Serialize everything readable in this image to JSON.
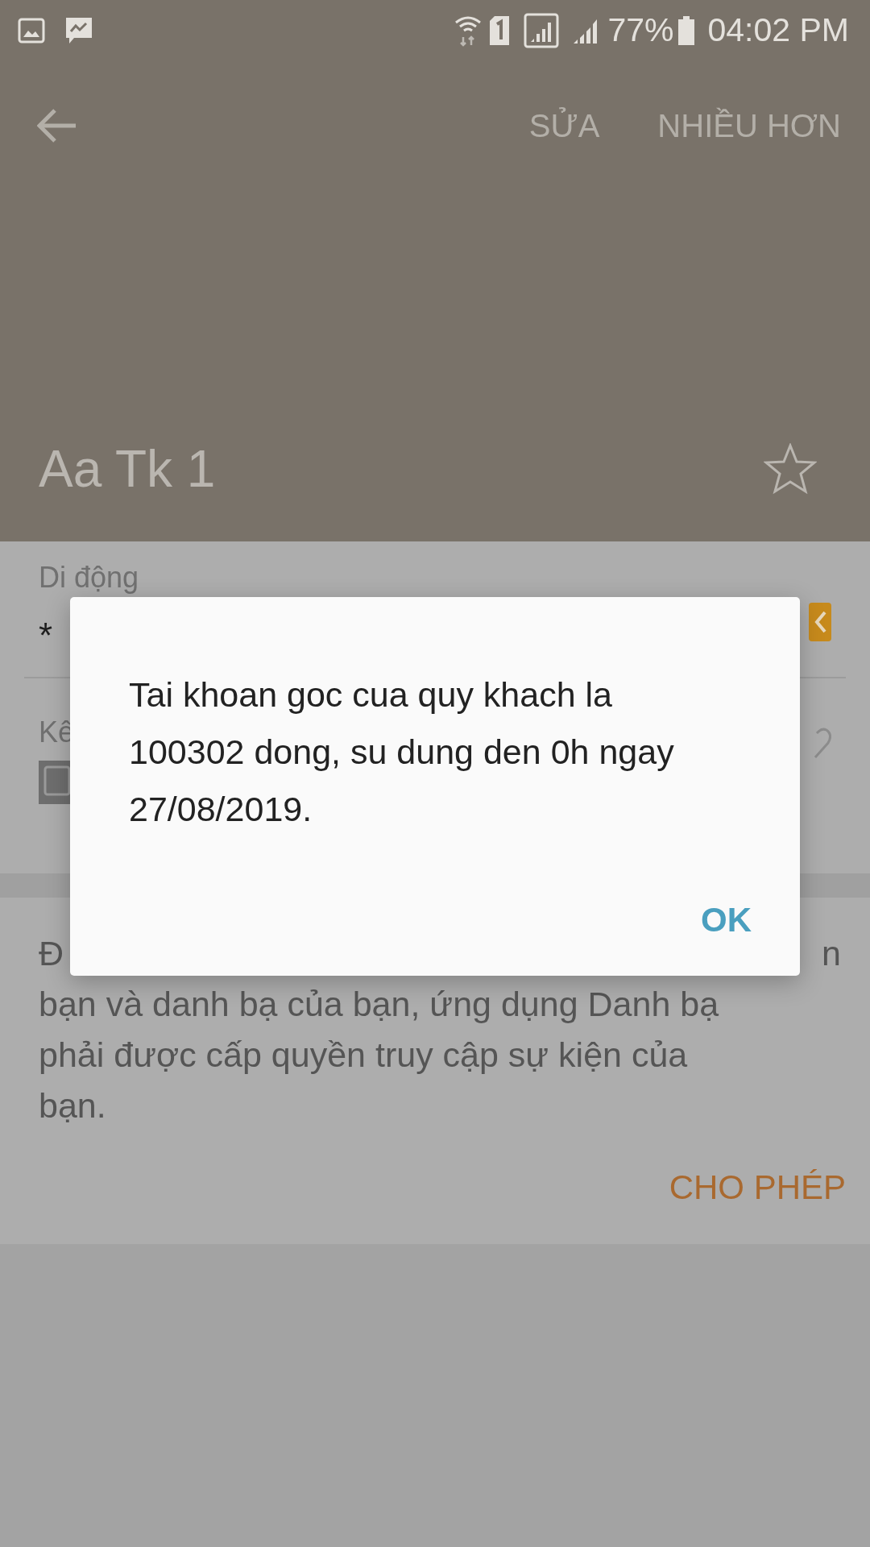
{
  "status_bar": {
    "battery": "77%",
    "time": "04:02 PM"
  },
  "app_bar": {
    "actions": [
      "SỬA",
      "NHIỀU HƠN"
    ]
  },
  "contact": {
    "name": "Aa Tk 1",
    "favorite": false
  },
  "fields": [
    {
      "label": "Di động",
      "value": "*"
    },
    {
      "label": "Kê"
    }
  ],
  "permission": {
    "first_line_start": "Đ",
    "first_line_end": "n",
    "lines": [
      "bạn và danh bạ của bạn, ứng dụng Danh bạ",
      "phải được cấp quyền truy cập sự kiện của",
      "bạn."
    ],
    "button": "CHO PHÉP"
  },
  "dialog": {
    "message": "Tai khoan goc cua quy khach la 100302 dong, su dung den 0h ngay 27/08/2019.",
    "button": "OK"
  }
}
